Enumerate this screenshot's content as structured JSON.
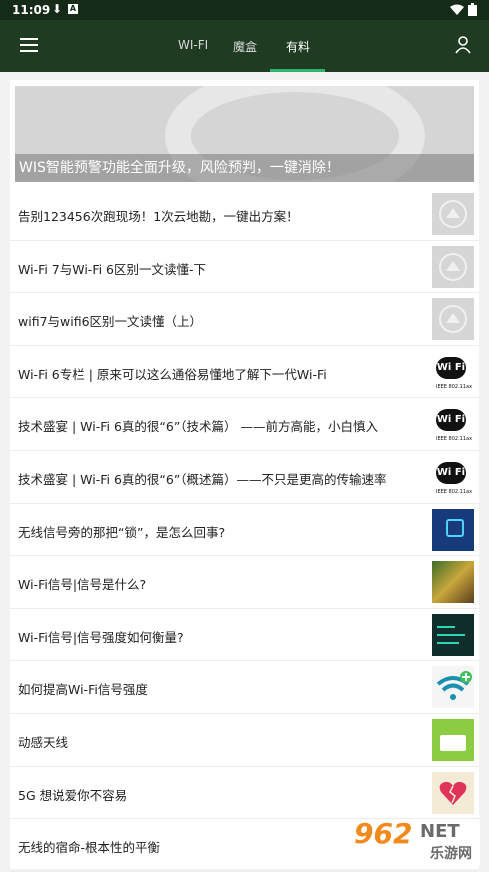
{
  "status_bar": {
    "time": "11:09",
    "download_icon": "download-icon",
    "a_badge": "A"
  },
  "app_bar": {
    "tabs": [
      {
        "label": "WI-FI"
      },
      {
        "label": "魔盒"
      },
      {
        "label": "有料"
      }
    ],
    "active_tab_index": 2,
    "accent_color": "#31b36b",
    "bar_color": "#1f3b22"
  },
  "banner": {
    "caption": "WIS智能预警功能全面升级，风险预判，一键消除！"
  },
  "articles": [
    {
      "title": "告别123456次跑现场！1次云地勘，一键出方案！",
      "thumb": "placeholder"
    },
    {
      "title": "Wi-Fi 7与Wi-Fi 6区别一文读懂-下",
      "thumb": "placeholder"
    },
    {
      "title": "wifi7与wifi6区别一文读懂（上）",
      "thumb": "placeholder"
    },
    {
      "title": "Wi-Fi 6专栏 | 原来可以这么通俗易懂地了解下一代Wi-Fi",
      "thumb": "wifi6-logo"
    },
    {
      "title": "技术盛宴 | Wi-Fi 6真的很“6”（技术篇） ——前方高能，小白慎入",
      "thumb": "wifi6-logo"
    },
    {
      "title": "技术盛宴 | Wi-Fi 6真的很“6”（概述篇）——不只是更高的传输速率",
      "thumb": "wifi6-logo"
    },
    {
      "title": "无线信号旁的那把“锁”，是怎么回事?",
      "thumb": "lock-image"
    },
    {
      "title": "Wi-Fi信号|信号是什么?",
      "thumb": "signal-image"
    },
    {
      "title": "Wi-Fi信号|信号强度如何衡量?",
      "thumb": "signal-strength-image"
    },
    {
      "title": "如何提高Wi-Fi信号强度",
      "thumb": "wifi-boost-image"
    },
    {
      "title": "动感天线",
      "thumb": "antenna-image"
    },
    {
      "title": "5G 想说爱你不容易",
      "thumb": "broken-heart-image"
    },
    {
      "title": "无线的宿命-根本性的平衡",
      "thumb": "none"
    }
  ],
  "wifi_badge_text": "Wi Fi",
  "wifi_badge_sub": "IEEE 802.11ax",
  "watermark": {
    "number": "962",
    "suffix": "NET",
    "cn": "乐游网"
  }
}
